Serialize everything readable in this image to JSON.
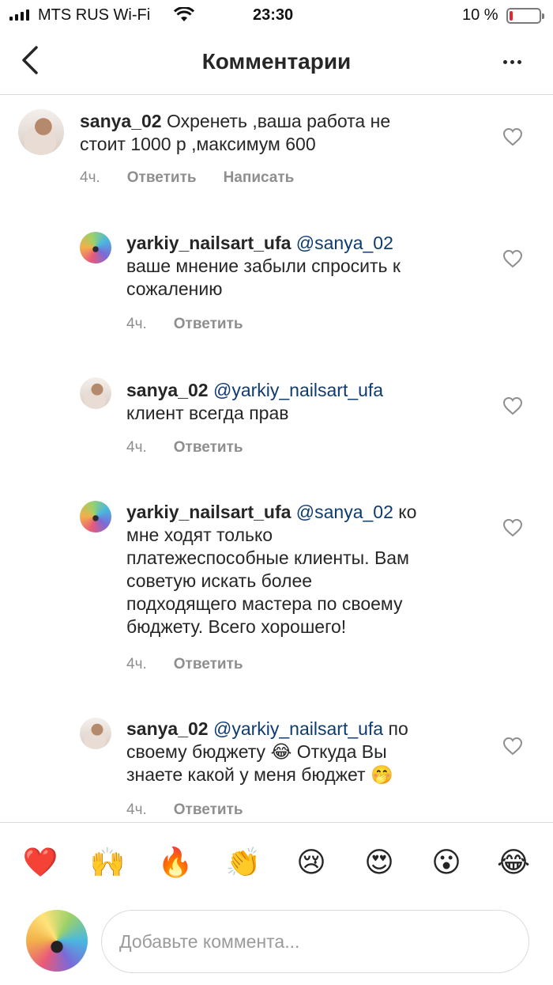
{
  "status_bar": {
    "carrier": "MTS RUS Wi-Fi",
    "time": "23:30",
    "battery_percent_label": "10 %",
    "battery_level": 0.1,
    "battery_color": "#e0282e"
  },
  "header": {
    "title": "Комментарии",
    "back_icon": "chevron-left-icon",
    "more_icon": "more-horizontal-icon"
  },
  "comments": [
    {
      "username": "sanya_02",
      "mention": "",
      "text": "Охренеть ,ваша работа не",
      "text_line2": "стоит 1000 р ,максимум 600",
      "time": "4ч.",
      "reply_label": "Ответить",
      "message_label": "Написать"
    },
    {
      "username": "yarkiy_nailsart_ufa",
      "mention": "@sanya_02",
      "line2": "ваше мнение забыли спросить к",
      "line3": "сожалению",
      "time": "4ч.",
      "reply_label": "Ответить"
    },
    {
      "username": "sanya_02",
      "mention": "@yarkiy_nailsart_ufa",
      "line2": "клиент всегда прав",
      "time": "4ч.",
      "reply_label": "Ответить"
    },
    {
      "username": "yarkiy_nailsart_ufa",
      "mention": "@sanya_02",
      "line1_tail": "ко",
      "line2": "мне ходят только",
      "line3": "платежеспособные клиенты. Вам",
      "line4": "советую искать более",
      "line5": "подходящего мастера по своему",
      "line6": "бюджету. Всего хорошего!",
      "time": "4ч.",
      "reply_label": "Ответить"
    },
    {
      "username": "sanya_02",
      "mention": "@yarkiy_nailsart_ufa",
      "line1_tail": "по",
      "line2": "своему бюджету 😂 Откуда Вы",
      "line3": "знаете какой у меня бюджет 🤭",
      "time": "4ч.",
      "reply_label": "Ответить"
    }
  ],
  "emoji_bar": [
    "❤️",
    "🙌",
    "🔥",
    "👏",
    "😢",
    "😍",
    "😮",
    "😂"
  ],
  "composer": {
    "placeholder": "Добавьте коммента..."
  }
}
